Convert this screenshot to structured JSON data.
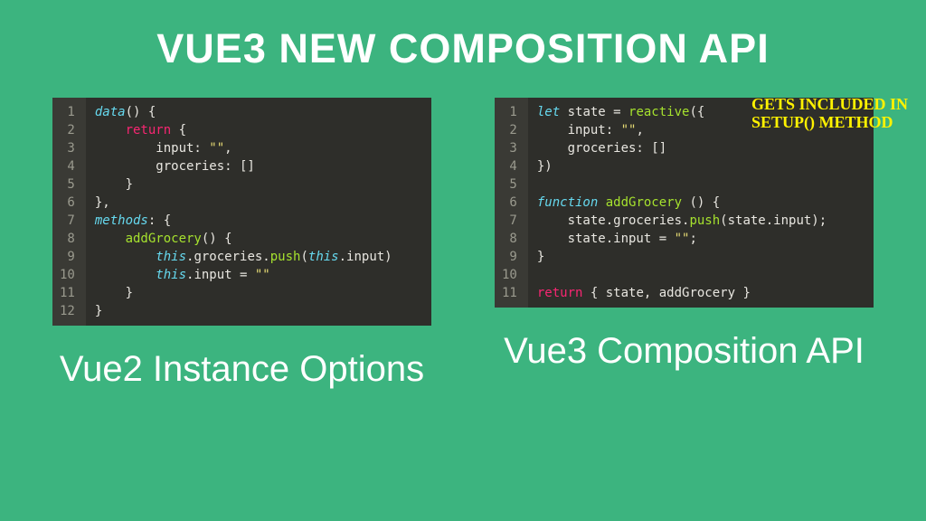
{
  "title": "VUE3 NEW COMPOSITION API",
  "annotation": "GETS INCLUDED IN SETUP() METHOD",
  "left": {
    "subtitle": "Vue2 Instance Options",
    "lines": 12,
    "code": {
      "l1a": "data",
      "l1b": "() {",
      "l2": "return",
      "l2b": " {",
      "l3a": "        input: ",
      "l3b": "\"\"",
      "l3c": ",",
      "l4": "        groceries: []",
      "l5": "    }",
      "l6": "},",
      "l7a": "methods",
      "l7b": ": {",
      "l8a": "addGrocery",
      "l8b": "() {",
      "l9a": "this",
      "l9b": ".groceries.",
      "l9c": "push",
      "l9d": "(",
      "l9e": "this",
      "l9f": ".input)",
      "l10a": "this",
      "l10b": ".input = ",
      "l10c": "\"\"",
      "l11": "    }",
      "l12": "}"
    }
  },
  "right": {
    "subtitle": "Vue3 Composition API",
    "lines": 11,
    "code": {
      "l1a": "let",
      "l1b": " state = ",
      "l1c": "reactive",
      "l1d": "({",
      "l2a": "    input: ",
      "l2b": "\"\"",
      "l2c": ",",
      "l3": "    groceries: []",
      "l4": "})",
      "l6a": "function",
      "l6b": "addGrocery",
      "l6c": " () {",
      "l7a": "    state.groceries.",
      "l7b": "push",
      "l7c": "(state.input);",
      "l8a": "    state.input = ",
      "l8b": "\"\"",
      "l8c": ";",
      "l9": "}",
      "l11a": "return",
      "l11b": " { state, addGrocery }"
    }
  }
}
